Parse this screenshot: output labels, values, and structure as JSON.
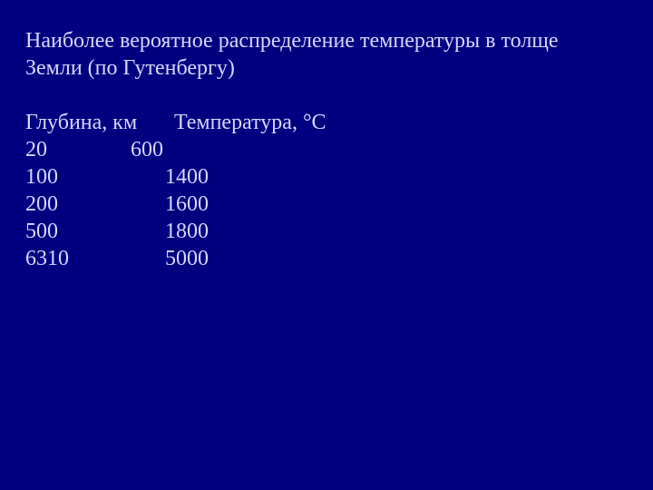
{
  "title_line1": "Наиболее вероятное распределение температуры в толще",
  "title_line2": "Земли (по Гутенбергу)",
  "headers": {
    "depth": "Глубина, км",
    "temperature": "Температура, °С"
  },
  "rows": [
    {
      "depth": "20",
      "temperature": "600"
    },
    {
      "depth": "100",
      "temperature": "1400"
    },
    {
      "depth": "200",
      "temperature": "1600"
    },
    {
      "depth": "500",
      "temperature": "1800"
    },
    {
      "depth": "6310",
      "temperature": "5000"
    }
  ]
}
